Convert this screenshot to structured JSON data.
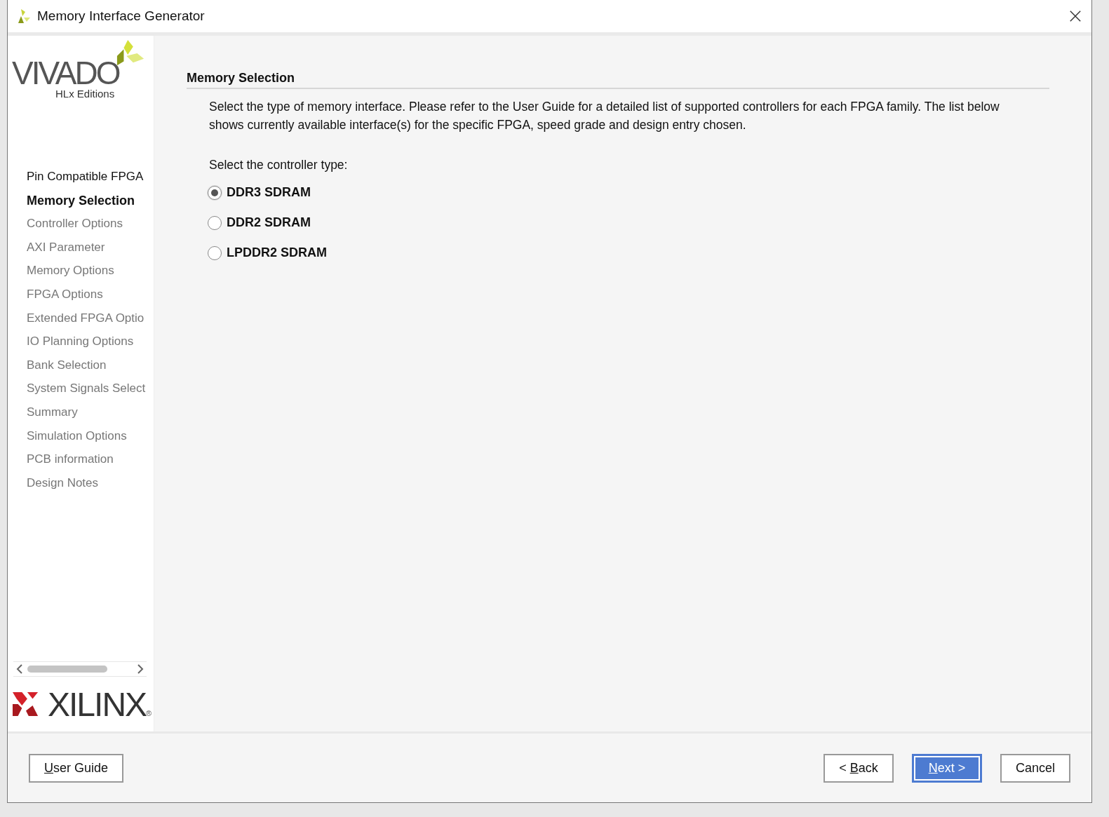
{
  "window": {
    "title": "Memory Interface Generator"
  },
  "branding": {
    "product": "VIVADO",
    "edition": "HLx Editions",
    "vendor": "XILINX",
    "registered": "®"
  },
  "steps": [
    {
      "label": "Pin Compatible FPGA",
      "selected": false,
      "disabled": false
    },
    {
      "label": "Memory Selection",
      "selected": true,
      "disabled": false
    },
    {
      "label": "Controller Options",
      "selected": false,
      "disabled": true
    },
    {
      "label": "AXI Parameter",
      "selected": false,
      "disabled": true
    },
    {
      "label": "Memory Options",
      "selected": false,
      "disabled": true
    },
    {
      "label": "FPGA Options",
      "selected": false,
      "disabled": true
    },
    {
      "label": "Extended FPGA Optio",
      "selected": false,
      "disabled": true
    },
    {
      "label": "IO Planning Options",
      "selected": false,
      "disabled": true
    },
    {
      "label": "Bank Selection",
      "selected": false,
      "disabled": true
    },
    {
      "label": "System Signals Select",
      "selected": false,
      "disabled": true
    },
    {
      "label": "Summary",
      "selected": false,
      "disabled": true
    },
    {
      "label": "Simulation Options",
      "selected": false,
      "disabled": true
    },
    {
      "label": "PCB information",
      "selected": false,
      "disabled": true
    },
    {
      "label": "Design Notes",
      "selected": false,
      "disabled": true
    }
  ],
  "page": {
    "heading": "Memory Selection",
    "description": "Select the type of memory interface. Please refer to the User Guide for a detailed list of supported controllers for each FPGA family. The list below shows currently available interface(s) for the specific FPGA, speed grade and design entry chosen.",
    "prompt": "Select the controller type:",
    "options": [
      {
        "label": "DDR3 SDRAM",
        "selected": true
      },
      {
        "label": "DDR2 SDRAM",
        "selected": false
      },
      {
        "label": "LPDDR2 SDRAM",
        "selected": false
      }
    ]
  },
  "buttons_left": [
    {
      "key": "U",
      "after": "ser Guide",
      "default": false
    }
  ],
  "buttons_right": [
    {
      "before": "< ",
      "key": "B",
      "after": "ack",
      "default": false
    },
    {
      "key": "N",
      "after": "ext >",
      "default": true
    },
    {
      "before": "Cancel",
      "default": false
    }
  ]
}
